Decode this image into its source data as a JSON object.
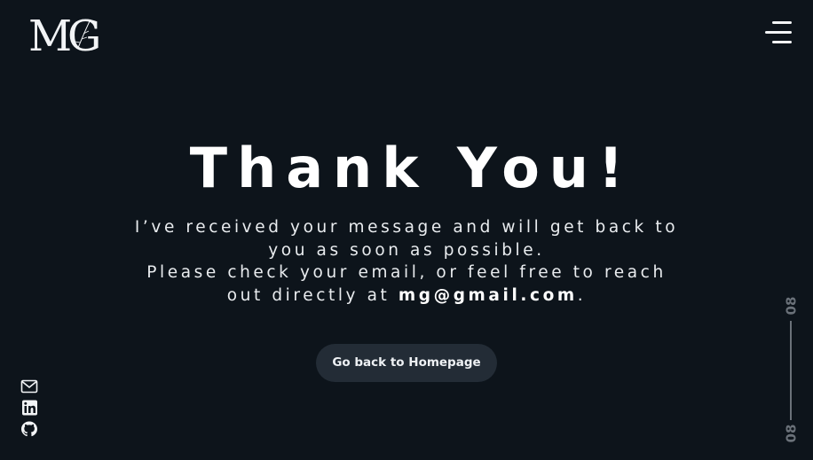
{
  "header": {
    "logo_text": "MG",
    "menu_icon": "hamburger-menu-icon"
  },
  "main": {
    "title": "Thank You!",
    "message_line1": "I’ve received your message and will get back to you as soon as possible.",
    "message_line2_prefix": "Please check your email, or feel free to reach out directly at",
    "email": "mg@gmail.com",
    "message_line2_suffix": ".",
    "home_button_label": "Go back to Homepage"
  },
  "social": {
    "icons": [
      "mail-icon",
      "linkedin-icon",
      "github-icon"
    ]
  },
  "counter": {
    "current": "08",
    "total": "08"
  },
  "colors": {
    "background": "#0d141b",
    "text": "#f2f4f6",
    "button_bg": "#232c36",
    "muted": "#6a7179"
  }
}
